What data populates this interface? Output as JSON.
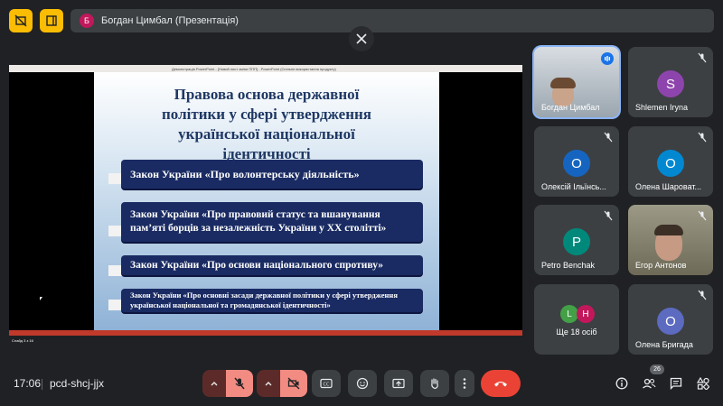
{
  "top": {
    "presenter_initial": "Б",
    "presenter_label": "Богдан Цимбал (Презентація)"
  },
  "presentation": {
    "window_title": "Демонстрація PowerPoint - [Новий лист зміни ППП] - PowerPoint (Спільне використання продукту)",
    "status_text": "Слайд 3 з 16",
    "slide": {
      "title_lines": [
        "Правова  основа державної",
        "політики  у  сфері утвердження",
        "української  національної",
        "ідентичності"
      ],
      "laws": [
        "Закон України «Про волонтерську діяльність»",
        "Закон України «Про правовий статус та вшанування пам’яті борців за незалежність України у ХХ столітті»",
        "Закон України «Про основи національного спротиву»",
        "Закон України «Про основні засади державної політики у сфері утвердження української національної та громадянської ідентичності»"
      ]
    }
  },
  "participants": [
    {
      "name": "Богдан Цимбал",
      "type": "video",
      "speaking": true
    },
    {
      "name": "Shlemen Iryna",
      "initial": "S",
      "color": "#8e44ad"
    },
    {
      "name": "Олексій Ільїнсь...",
      "initial": "О",
      "color": "#1565c0"
    },
    {
      "name": "Олена Шароват...",
      "initial": "О",
      "color": "#0288d1"
    },
    {
      "name": "Petro Benchak",
      "initial": "P",
      "color": "#00897b"
    },
    {
      "name": "Егор Антонов",
      "type": "video"
    },
    {
      "name": "Ще 18 осіб",
      "initials": [
        "L",
        "H"
      ],
      "colors": [
        "#43a047",
        "#c2185b"
      ]
    },
    {
      "name": "Олена Бригада",
      "initial": "О",
      "color": "#5c6bc0"
    }
  ],
  "bottom": {
    "time": "17:06",
    "meeting_code": "pcd-shcj-jjx",
    "people_count": "26"
  }
}
